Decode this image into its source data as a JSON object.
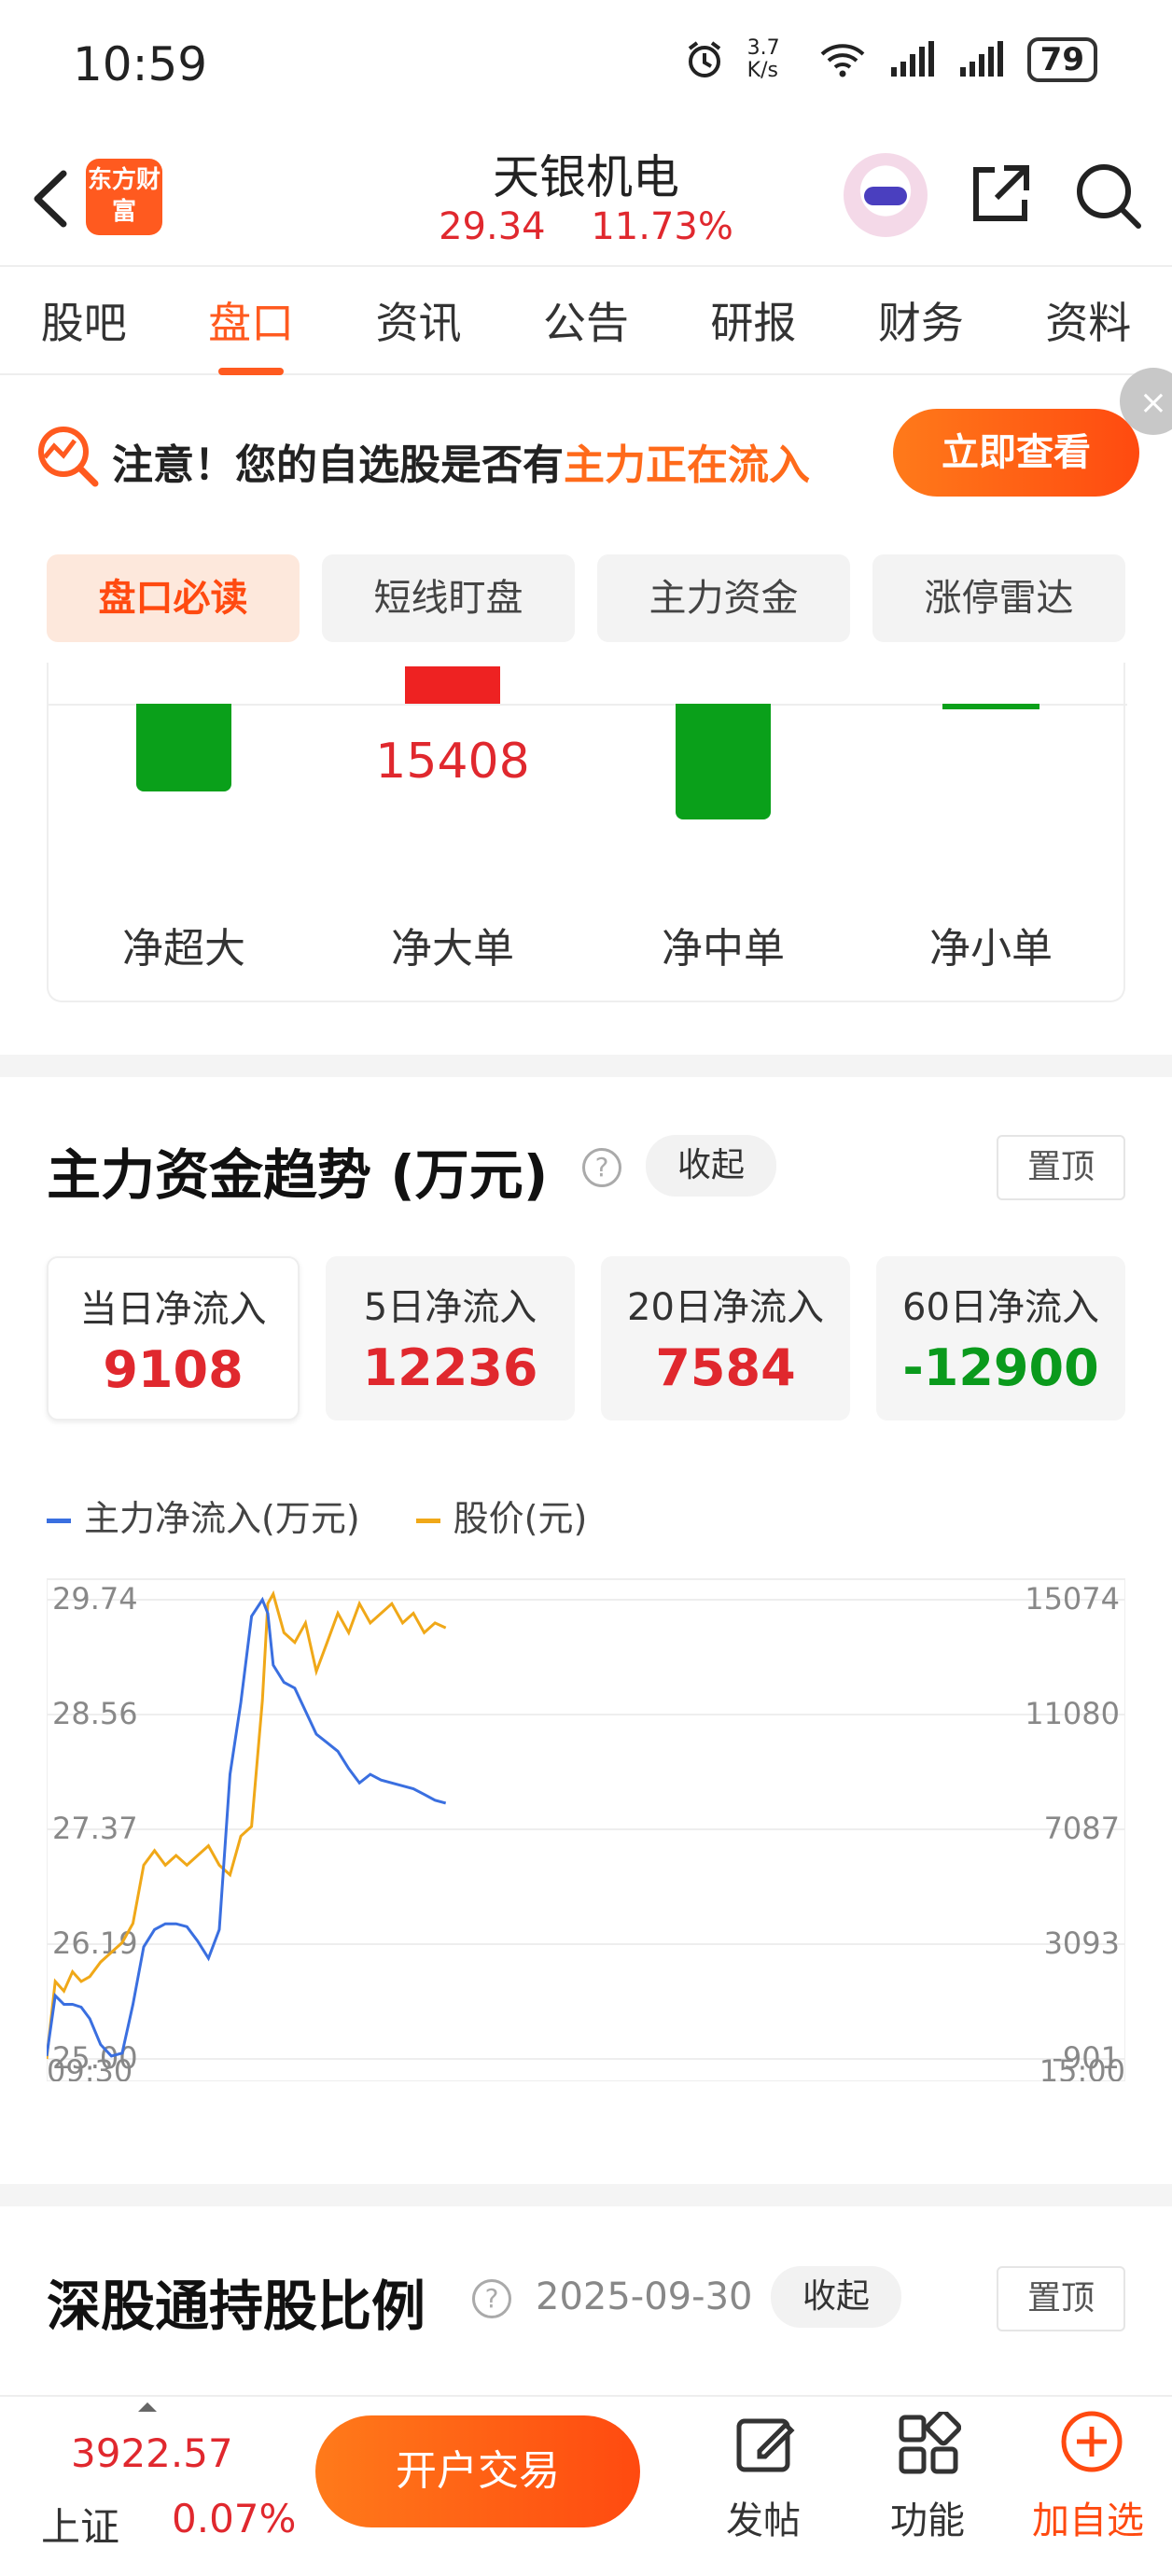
{
  "status_bar": {
    "time": "10:59",
    "net_speed": "3.7 K/s",
    "battery": "79"
  },
  "header": {
    "logo_text": "东方财富",
    "title": "天银机电",
    "price": "29.34",
    "change": "11.73%"
  },
  "tabs": [
    "股吧",
    "盘口",
    "资讯",
    "公告",
    "研报",
    "财务",
    "资料"
  ],
  "active_tab": 1,
  "banner": {
    "text_prefix": "注意！您的自选股是否有",
    "text_highlight": "主力正在流入",
    "button": "立即查看",
    "close": "×"
  },
  "subtabs": [
    "盘口必读",
    "短线盯盘",
    "主力资金",
    "涨停雷达"
  ],
  "flow": {
    "labels": [
      "净超大",
      "净大单",
      "净中单",
      "净小单"
    ],
    "big_order_value": "15408"
  },
  "trend": {
    "title": "主力资金趋势 (万元)",
    "help": "?",
    "collapse": "收起",
    "pin": "置顶",
    "stats": [
      {
        "label": "当日净流入",
        "value": "9108",
        "color": "red"
      },
      {
        "label": "5日净流入",
        "value": "12236",
        "color": "red"
      },
      {
        "label": "20日净流入",
        "value": "7584",
        "color": "red"
      },
      {
        "label": "60日净流入",
        "value": "-12900",
        "color": "green"
      }
    ],
    "legend": [
      {
        "name": "主力净流入(万元)",
        "color": "#3a6fe0"
      },
      {
        "name": "股价(元)",
        "color": "#f0a818"
      }
    ]
  },
  "chart_data": {
    "type": "line",
    "x_start": "09:30",
    "x_end": "15:00",
    "y_left": [
      "29.74",
      "28.56",
      "27.37",
      "26.19",
      "25.00"
    ],
    "y_right": [
      "15074",
      "11080",
      "7087",
      "3093",
      "-901"
    ],
    "ylim_left": [
      25.0,
      29.74
    ],
    "ylim_right": [
      -901,
      15074
    ],
    "series": [
      {
        "name": "股价(元)",
        "axis": "left",
        "color": "#f0a818",
        "values": [
          25.0,
          25.8,
          25.7,
          25.9,
          25.8,
          25.85,
          26.0,
          26.1,
          26.2,
          26.4,
          27.0,
          27.15,
          27.0,
          27.1,
          27.0,
          27.1,
          27.2,
          27.0,
          26.9,
          27.3,
          27.4,
          28.7,
          29.7,
          29.8,
          29.4,
          29.3,
          29.5,
          29.0,
          29.3,
          29.6,
          29.4,
          29.7,
          29.5,
          29.6,
          29.7,
          29.5,
          29.6,
          29.4,
          29.5,
          29.45
        ],
        "x_frac": [
          0,
          0.008,
          0.016,
          0.024,
          0.032,
          0.04,
          0.05,
          0.06,
          0.07,
          0.08,
          0.09,
          0.1,
          0.11,
          0.12,
          0.13,
          0.14,
          0.15,
          0.16,
          0.17,
          0.18,
          0.19,
          0.2,
          0.205,
          0.21,
          0.22,
          0.23,
          0.24,
          0.25,
          0.26,
          0.27,
          0.28,
          0.29,
          0.3,
          0.31,
          0.32,
          0.33,
          0.34,
          0.35,
          0.36,
          0.37
        ]
      },
      {
        "name": "主力净流入(万元)",
        "axis": "right",
        "color": "#3a6fe0",
        "values": [
          -800,
          1300,
          1000,
          1000,
          900,
          500,
          -400,
          -800,
          -700,
          1000,
          3000,
          3600,
          3800,
          3800,
          3700,
          3200,
          2600,
          3600,
          9000,
          11500,
          14500,
          15074,
          14600,
          12800,
          12200,
          12000,
          11200,
          10400,
          10100,
          9800,
          9200,
          8700,
          9000,
          8800,
          8700,
          8600,
          8500,
          8300,
          8100,
          8000
        ],
        "x_frac": [
          0,
          0.008,
          0.016,
          0.024,
          0.032,
          0.04,
          0.05,
          0.06,
          0.07,
          0.08,
          0.09,
          0.1,
          0.11,
          0.12,
          0.13,
          0.14,
          0.15,
          0.16,
          0.17,
          0.18,
          0.19,
          0.2,
          0.205,
          0.21,
          0.22,
          0.23,
          0.24,
          0.25,
          0.26,
          0.27,
          0.28,
          0.29,
          0.3,
          0.31,
          0.32,
          0.33,
          0.34,
          0.35,
          0.36,
          0.37
        ]
      }
    ]
  },
  "hk": {
    "title": "深股通持股比例",
    "help": "?",
    "date": "2025-09-30",
    "collapse": "收起",
    "pin": "置顶"
  },
  "bottom": {
    "index_value": "3922.57",
    "index_name": "上证",
    "index_change": "0.07%",
    "trade": "开户交易",
    "post": "发帖",
    "func": "功能",
    "add": "加自选"
  }
}
